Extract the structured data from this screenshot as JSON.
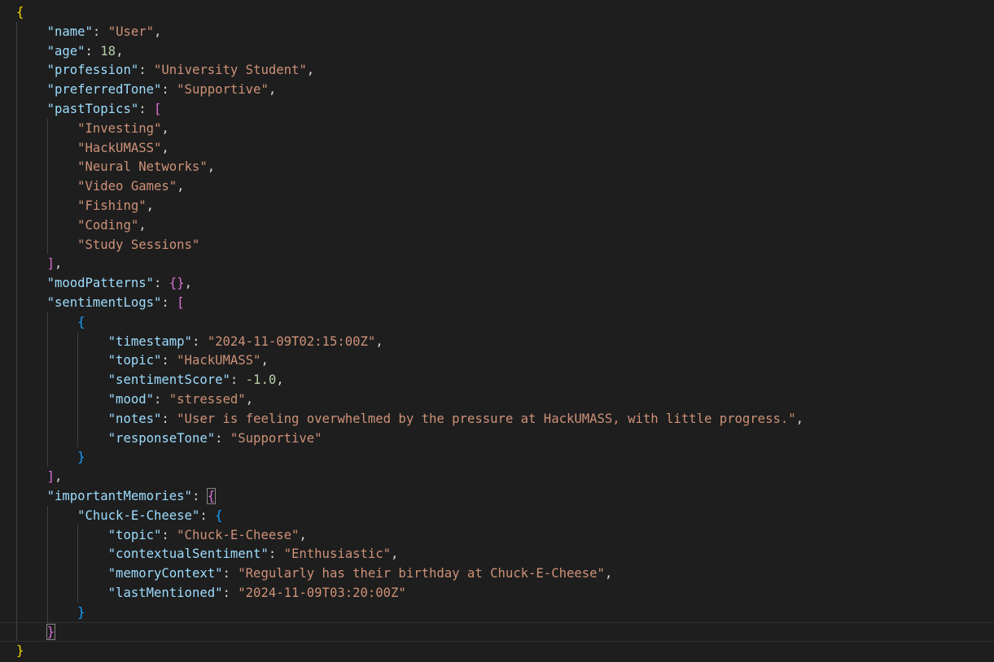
{
  "theme": {
    "background": "#1e1e1e",
    "key_color": "#9cdcfe",
    "string_color": "#ce9178",
    "number_color": "#b5cea8",
    "punctuation_color": "#d4d4d4",
    "bracket_level1": "#ffd700",
    "bracket_level2": "#da70d6",
    "bracket_level3": "#179fff"
  },
  "lines": [
    {
      "indent": 0,
      "tokens": [
        {
          "t": "{",
          "c": "br-gold"
        }
      ]
    },
    {
      "indent": 1,
      "tokens": [
        {
          "t": "\"name\"",
          "c": "tk-key"
        },
        {
          "t": ": ",
          "c": "tk-p"
        },
        {
          "t": "\"User\"",
          "c": "tk-str"
        },
        {
          "t": ",",
          "c": "tk-p"
        }
      ]
    },
    {
      "indent": 1,
      "tokens": [
        {
          "t": "\"age\"",
          "c": "tk-key"
        },
        {
          "t": ": ",
          "c": "tk-p"
        },
        {
          "t": "18",
          "c": "tk-num"
        },
        {
          "t": ",",
          "c": "tk-p"
        }
      ]
    },
    {
      "indent": 1,
      "tokens": [
        {
          "t": "\"profession\"",
          "c": "tk-key"
        },
        {
          "t": ": ",
          "c": "tk-p"
        },
        {
          "t": "\"University Student\"",
          "c": "tk-str"
        },
        {
          "t": ",",
          "c": "tk-p"
        }
      ]
    },
    {
      "indent": 1,
      "tokens": [
        {
          "t": "\"preferredTone\"",
          "c": "tk-key"
        },
        {
          "t": ": ",
          "c": "tk-p"
        },
        {
          "t": "\"Supportive\"",
          "c": "tk-str"
        },
        {
          "t": ",",
          "c": "tk-p"
        }
      ]
    },
    {
      "indent": 1,
      "tokens": [
        {
          "t": "\"pastTopics\"",
          "c": "tk-key"
        },
        {
          "t": ": ",
          "c": "tk-p"
        },
        {
          "t": "[",
          "c": "br-pink"
        }
      ]
    },
    {
      "indent": 2,
      "tokens": [
        {
          "t": "\"Investing\"",
          "c": "tk-str"
        },
        {
          "t": ",",
          "c": "tk-p"
        }
      ]
    },
    {
      "indent": 2,
      "tokens": [
        {
          "t": "\"HackUMASS\"",
          "c": "tk-str"
        },
        {
          "t": ",",
          "c": "tk-p"
        }
      ]
    },
    {
      "indent": 2,
      "tokens": [
        {
          "t": "\"Neural Networks\"",
          "c": "tk-str"
        },
        {
          "t": ",",
          "c": "tk-p"
        }
      ]
    },
    {
      "indent": 2,
      "tokens": [
        {
          "t": "\"Video Games\"",
          "c": "tk-str"
        },
        {
          "t": ",",
          "c": "tk-p"
        }
      ]
    },
    {
      "indent": 2,
      "tokens": [
        {
          "t": "\"Fishing\"",
          "c": "tk-str"
        },
        {
          "t": ",",
          "c": "tk-p"
        }
      ]
    },
    {
      "indent": 2,
      "tokens": [
        {
          "t": "\"Coding\"",
          "c": "tk-str"
        },
        {
          "t": ",",
          "c": "tk-p"
        }
      ]
    },
    {
      "indent": 2,
      "tokens": [
        {
          "t": "\"Study Sessions\"",
          "c": "tk-str"
        }
      ]
    },
    {
      "indent": 1,
      "tokens": [
        {
          "t": "]",
          "c": "br-pink"
        },
        {
          "t": ",",
          "c": "tk-p"
        }
      ]
    },
    {
      "indent": 1,
      "tokens": [
        {
          "t": "\"moodPatterns\"",
          "c": "tk-key"
        },
        {
          "t": ": ",
          "c": "tk-p"
        },
        {
          "t": "{}",
          "c": "br-pink"
        },
        {
          "t": ",",
          "c": "tk-p"
        }
      ]
    },
    {
      "indent": 1,
      "tokens": [
        {
          "t": "\"sentimentLogs\"",
          "c": "tk-key"
        },
        {
          "t": ": ",
          "c": "tk-p"
        },
        {
          "t": "[",
          "c": "br-pink"
        }
      ]
    },
    {
      "indent": 2,
      "tokens": [
        {
          "t": "{",
          "c": "br-blue"
        }
      ]
    },
    {
      "indent": 3,
      "tokens": [
        {
          "t": "\"timestamp\"",
          "c": "tk-key"
        },
        {
          "t": ": ",
          "c": "tk-p"
        },
        {
          "t": "\"2024-11-09T02:15:00Z\"",
          "c": "tk-str"
        },
        {
          "t": ",",
          "c": "tk-p"
        }
      ]
    },
    {
      "indent": 3,
      "tokens": [
        {
          "t": "\"topic\"",
          "c": "tk-key"
        },
        {
          "t": ": ",
          "c": "tk-p"
        },
        {
          "t": "\"HackUMASS\"",
          "c": "tk-str"
        },
        {
          "t": ",",
          "c": "tk-p"
        }
      ]
    },
    {
      "indent": 3,
      "tokens": [
        {
          "t": "\"sentimentScore\"",
          "c": "tk-key"
        },
        {
          "t": ": ",
          "c": "tk-p"
        },
        {
          "t": "-1.0",
          "c": "tk-num"
        },
        {
          "t": ",",
          "c": "tk-p"
        }
      ]
    },
    {
      "indent": 3,
      "tokens": [
        {
          "t": "\"mood\"",
          "c": "tk-key"
        },
        {
          "t": ": ",
          "c": "tk-p"
        },
        {
          "t": "\"stressed\"",
          "c": "tk-str"
        },
        {
          "t": ",",
          "c": "tk-p"
        }
      ]
    },
    {
      "indent": 3,
      "tokens": [
        {
          "t": "\"notes\"",
          "c": "tk-key"
        },
        {
          "t": ": ",
          "c": "tk-p"
        },
        {
          "t": "\"User is feeling overwhelmed by the pressure at HackUMASS, with little progress.\"",
          "c": "tk-str"
        },
        {
          "t": ",",
          "c": "tk-p"
        }
      ]
    },
    {
      "indent": 3,
      "tokens": [
        {
          "t": "\"responseTone\"",
          "c": "tk-key"
        },
        {
          "t": ": ",
          "c": "tk-p"
        },
        {
          "t": "\"Supportive\"",
          "c": "tk-str"
        }
      ]
    },
    {
      "indent": 2,
      "tokens": [
        {
          "t": "}",
          "c": "br-blue"
        }
      ]
    },
    {
      "indent": 1,
      "tokens": [
        {
          "t": "]",
          "c": "br-pink"
        },
        {
          "t": ",",
          "c": "tk-p"
        }
      ]
    },
    {
      "indent": 1,
      "tokens": [
        {
          "t": "\"importantMemories\"",
          "c": "tk-key"
        },
        {
          "t": ": ",
          "c": "tk-p"
        },
        {
          "t": "{",
          "c": "br-pink br-match"
        }
      ]
    },
    {
      "indent": 2,
      "tokens": [
        {
          "t": "\"Chuck-E-Cheese\"",
          "c": "tk-key"
        },
        {
          "t": ": ",
          "c": "tk-p"
        },
        {
          "t": "{",
          "c": "br-blue"
        }
      ]
    },
    {
      "indent": 3,
      "tokens": [
        {
          "t": "\"topic\"",
          "c": "tk-key"
        },
        {
          "t": ": ",
          "c": "tk-p"
        },
        {
          "t": "\"Chuck-E-Cheese\"",
          "c": "tk-str"
        },
        {
          "t": ",",
          "c": "tk-p"
        }
      ]
    },
    {
      "indent": 3,
      "tokens": [
        {
          "t": "\"contextualSentiment\"",
          "c": "tk-key"
        },
        {
          "t": ": ",
          "c": "tk-p"
        },
        {
          "t": "\"Enthusiastic\"",
          "c": "tk-str"
        },
        {
          "t": ",",
          "c": "tk-p"
        }
      ]
    },
    {
      "indent": 3,
      "tokens": [
        {
          "t": "\"memoryContext\"",
          "c": "tk-key"
        },
        {
          "t": ": ",
          "c": "tk-p"
        },
        {
          "t": "\"Regularly has their birthday at Chuck-E-Cheese\"",
          "c": "tk-str"
        },
        {
          "t": ",",
          "c": "tk-p"
        }
      ]
    },
    {
      "indent": 3,
      "tokens": [
        {
          "t": "\"lastMentioned\"",
          "c": "tk-key"
        },
        {
          "t": ": ",
          "c": "tk-p"
        },
        {
          "t": "\"2024-11-09T03:20:00Z\"",
          "c": "tk-str"
        }
      ]
    },
    {
      "indent": 2,
      "tokens": [
        {
          "t": "}",
          "c": "br-blue"
        }
      ]
    },
    {
      "indent": 1,
      "tokens": [
        {
          "t": "}",
          "c": "br-pink br-match"
        }
      ],
      "current": true
    },
    {
      "indent": 0,
      "tokens": [
        {
          "t": "}",
          "c": "br-gold"
        }
      ]
    }
  ]
}
